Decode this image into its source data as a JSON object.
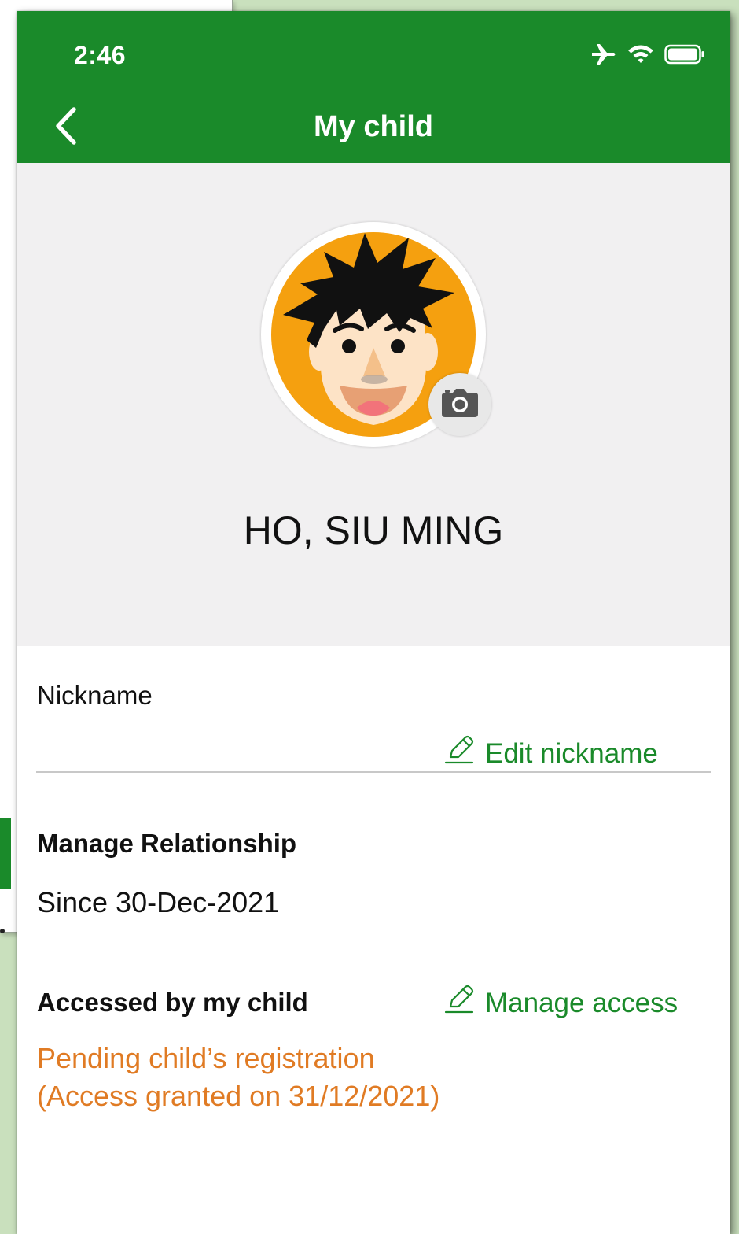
{
  "status_bar": {
    "time": "2:46",
    "icons": [
      "airplane-icon",
      "wifi-icon",
      "battery-icon"
    ]
  },
  "header": {
    "title": "My child",
    "back_icon": "chevron-left-icon"
  },
  "profile": {
    "name": "HO, SIU MING",
    "camera_icon": "camera-icon"
  },
  "nickname": {
    "label": "Nickname",
    "edit_label": "Edit nickname"
  },
  "relationship": {
    "heading": "Manage Relationship",
    "since": "Since 30-Dec-2021"
  },
  "access": {
    "heading": "Accessed by my child",
    "manage_label": "Manage access",
    "status_line1": "Pending child’s registration",
    "status_line2": "(Access granted on 31/12/2021)"
  },
  "colors": {
    "brand_green": "#1a8a2a",
    "pending_orange": "#e07b24",
    "avatar_orange": "#f5a00f",
    "background": "#c9e0bd"
  }
}
